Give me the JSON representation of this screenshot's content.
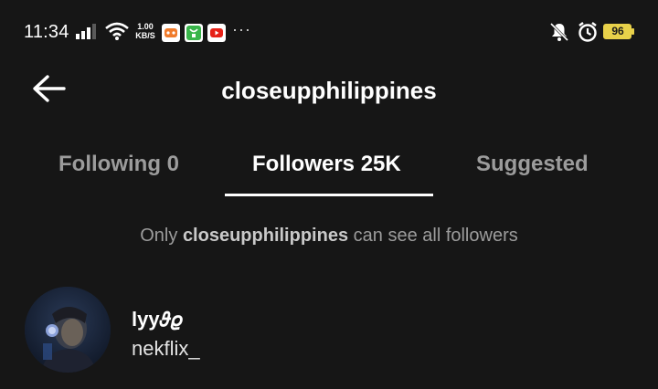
{
  "status_bar": {
    "time": "11:34",
    "speed_value": "1.00",
    "speed_unit": "KB/S",
    "overflow": "···",
    "battery": "96",
    "battery_color": "#e8d14a",
    "icons": [
      "signal-icon",
      "wifi-icon",
      "game-app-icon",
      "shop-app-icon",
      "youtube-app-icon",
      "mute-icon",
      "alarm-icon",
      "battery-icon"
    ]
  },
  "header": {
    "title": "closeupphilippines",
    "back_icon": "back-arrow-icon"
  },
  "tabs": [
    {
      "label": "Following 0",
      "active": false
    },
    {
      "label": "Followers 25K",
      "active": true
    },
    {
      "label": "Suggested",
      "active": false
    }
  ],
  "notice": {
    "prefix": "Only",
    "account": "closeupphilippines",
    "suffix": "can see all followers"
  },
  "followers": [
    {
      "display_name": "lyy𝜗𝜚",
      "username": "nekflix_"
    }
  ],
  "colors": {
    "background": "#161616",
    "text_primary": "#ffffff",
    "text_secondary": "#9c9c9c"
  }
}
